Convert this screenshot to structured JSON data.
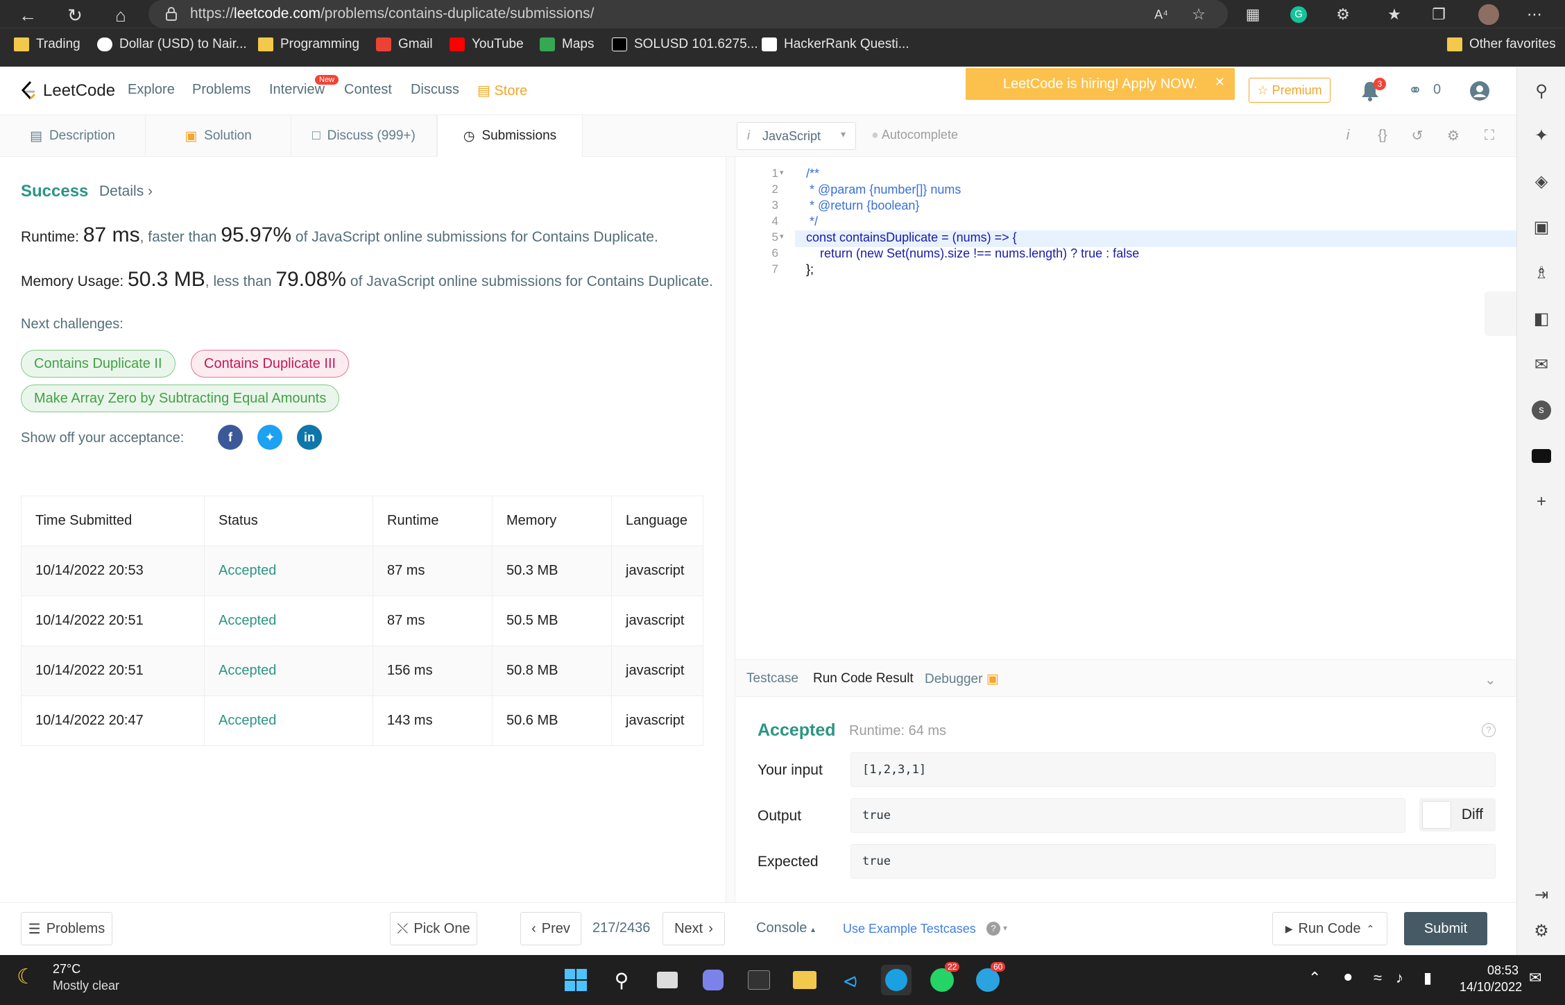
{
  "browser": {
    "url_prefix": "https://",
    "url_host": "leetcode.com",
    "url_path": "/problems/contains-duplicate/submissions/",
    "bookmarks": [
      "Trading",
      "Dollar (USD) to Nair...",
      "Programming",
      "Gmail",
      "YouTube",
      "Maps",
      "SOLUSD 101.6275...",
      "HackerRank Questi..."
    ],
    "other_favorites": "Other favorites"
  },
  "header": {
    "logo": "LeetCode",
    "nav": [
      "Explore",
      "Problems",
      "Interview",
      "Contest",
      "Discuss"
    ],
    "new_badge": "New",
    "store": "Store",
    "hiring": "LeetCode is hiring! Apply NOW.",
    "premium": "Premium",
    "notifications": "3",
    "streak": "0"
  },
  "tabs": {
    "description": "Description",
    "solution": "Solution",
    "discuss": "Discuss (999+)",
    "submissions": "Submissions"
  },
  "result": {
    "status": "Success",
    "details": "Details",
    "runtime_label": "Runtime: ",
    "runtime_value": "87 ms",
    "runtime_mid": ", faster than ",
    "runtime_pct": "95.97%",
    "runtime_tail": " of JavaScript online submissions for Contains Duplicate.",
    "memory_label": "Memory Usage: ",
    "memory_value": "50.3 MB",
    "memory_mid": ", less than ",
    "memory_pct": "79.08%",
    "memory_tail": " of JavaScript online submissions for Contains Duplicate.",
    "next_challenges": "Next challenges:",
    "challenges": [
      "Contains Duplicate II",
      "Contains Duplicate III",
      "Make Array Zero by Subtracting Equal Amounts"
    ],
    "share": "Show off your acceptance:"
  },
  "submissions_table": {
    "headers": [
      "Time Submitted",
      "Status",
      "Runtime",
      "Memory",
      "Language"
    ],
    "rows": [
      [
        "10/14/2022 20:53",
        "Accepted",
        "87 ms",
        "50.3 MB",
        "javascript"
      ],
      [
        "10/14/2022 20:51",
        "Accepted",
        "87 ms",
        "50.5 MB",
        "javascript"
      ],
      [
        "10/14/2022 20:51",
        "Accepted",
        "156 ms",
        "50.8 MB",
        "javascript"
      ],
      [
        "10/14/2022 20:47",
        "Accepted",
        "143 ms",
        "50.6 MB",
        "javascript"
      ]
    ]
  },
  "editor": {
    "language": "JavaScript",
    "autocomplete": "Autocomplete",
    "line_numbers": [
      "1",
      "2",
      "3",
      "4",
      "5",
      "6",
      "7"
    ],
    "code": [
      "/**",
      " * @param {number[]} nums",
      " * @return {boolean}",
      " */",
      "const containsDuplicate = (nums) => {",
      "    return (new Set(nums).size !== nums.length) ? true : false",
      "};"
    ]
  },
  "run_panel": {
    "tabs": [
      "Testcase",
      "Run Code Result",
      "Debugger"
    ],
    "status": "Accepted",
    "runtime": "Runtime: 64 ms",
    "your_input_label": "Your input",
    "your_input": "[1,2,3,1]",
    "output_label": "Output",
    "output": "true",
    "expected_label": "Expected",
    "expected": "true",
    "diff": "Diff"
  },
  "bottom": {
    "problems": "Problems",
    "pick_one": "Pick One",
    "prev": "Prev",
    "page": "217/2436",
    "next": "Next",
    "console": "Console",
    "use_example": "Use Example Testcases",
    "run_code": "Run Code",
    "submit": "Submit"
  },
  "taskbar": {
    "temperature": "27°C",
    "weather": "Mostly clear",
    "whatsapp_badge": "22",
    "telegram_badge": "60",
    "time": "08:53",
    "date": "14/10/2022"
  },
  "colors": {
    "accent_green": "#2b9583",
    "store_orange": "#f4a629",
    "submit_bg": "#455a64"
  }
}
